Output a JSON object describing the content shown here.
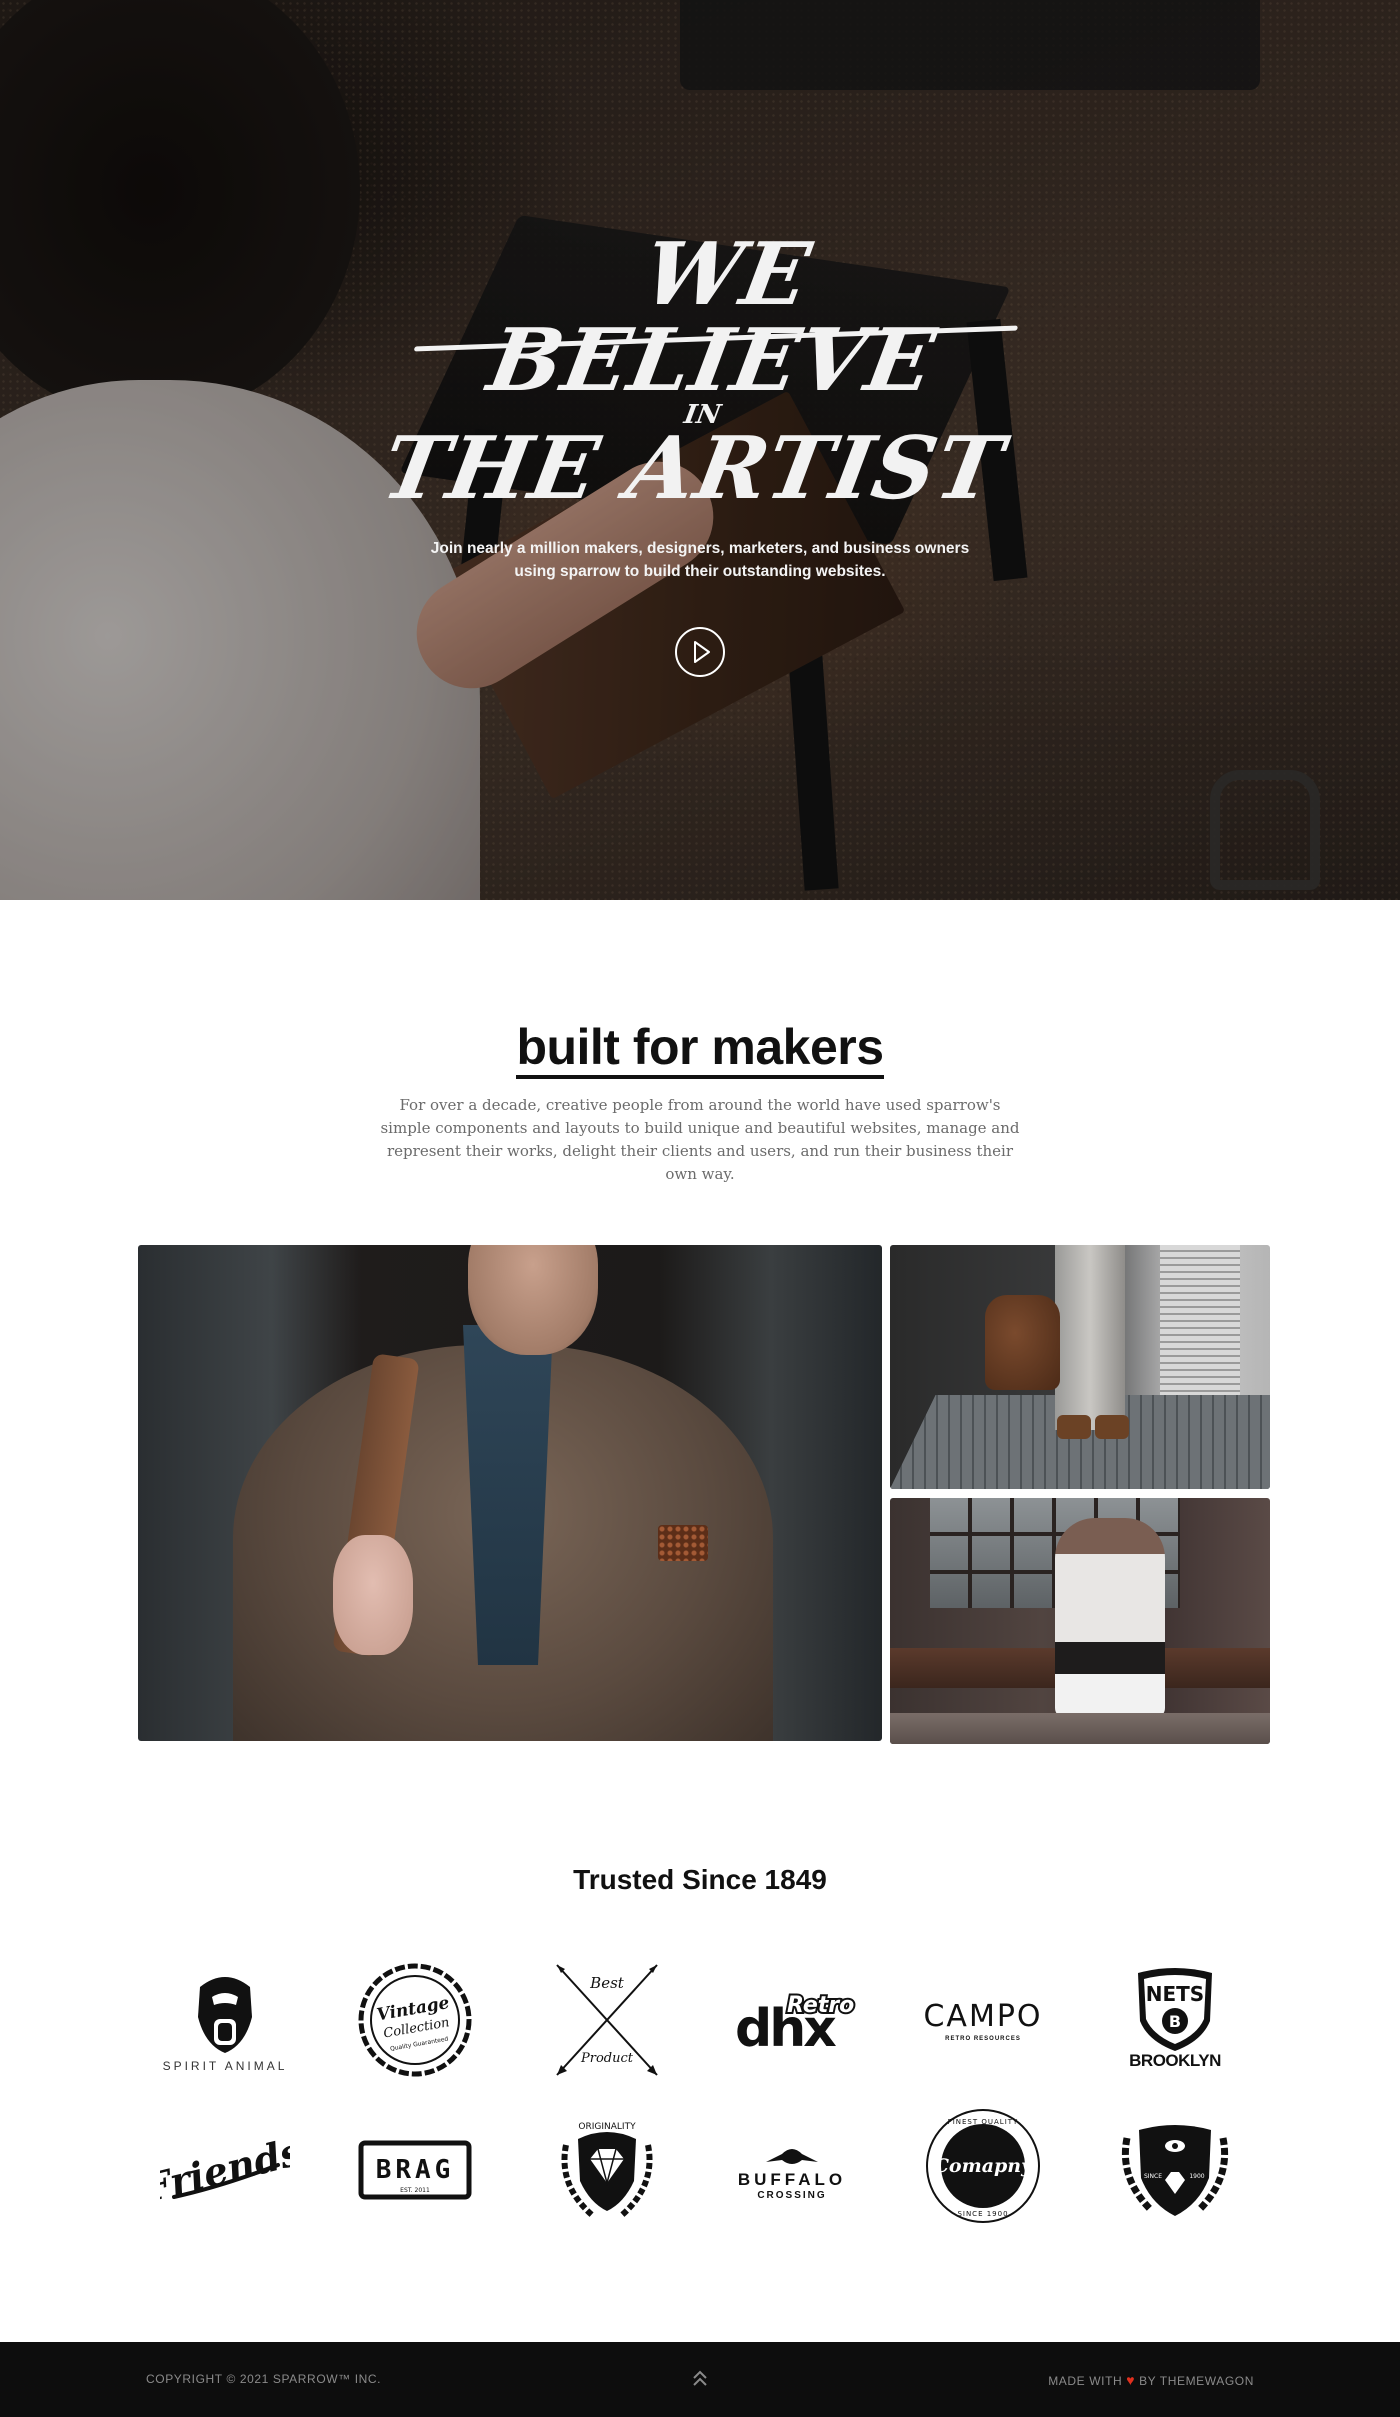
{
  "hero": {
    "title_line1": "We Believe",
    "title_line2": "in",
    "title_line3": "The Artist",
    "subtitle": "Join nearly a million makers, designers, marketers, and business owners using sparrow to build their outstanding websites.",
    "play_icon": "play-circle-icon"
  },
  "intro": {
    "title": "built for makers",
    "description": "For over a decade, creative people from around the world have used sparrow's simple components and layouts to build unique and beautiful websites, manage and represent their works, delight their clients and users, and run their business their own way."
  },
  "gallery": {
    "images": [
      "man-with-leather-bag",
      "man-standing-with-bag",
      "man-sitting-on-bench"
    ]
  },
  "trusted": {
    "title": "Trusted Since 1849",
    "logos": [
      {
        "name": "spirit-animal",
        "text": "SPIRIT ANIMAL"
      },
      {
        "name": "vintage-collection",
        "text1": "Vintage",
        "text2": "Collection",
        "text3": "Quality Guaranteed"
      },
      {
        "name": "best-product",
        "text1": "Best",
        "text2": "Product"
      },
      {
        "name": "retro-dhx",
        "text1": "dhx",
        "text2": "Retro"
      },
      {
        "name": "campo",
        "text1": "CAMPO",
        "text2": "RETRO RESOURCES"
      },
      {
        "name": "nets-brooklyn",
        "text1": "NETS",
        "text2": "B",
        "text3": "BROOKLYN"
      },
      {
        "name": "friends",
        "text": "Friends"
      },
      {
        "name": "brag",
        "text1": "BRAG",
        "text2": "EST. 2011"
      },
      {
        "name": "originality",
        "text": "ORIGINALITY"
      },
      {
        "name": "buffalo-crossing",
        "text1": "BUFFALO",
        "text2": "CROSSING"
      },
      {
        "name": "comapny",
        "text1": "FINEST QUALITY",
        "text2": "Comapny",
        "text3": "SINCE 1900"
      },
      {
        "name": "since-1900-crest",
        "text1": "SINCE",
        "text2": "1900"
      }
    ]
  },
  "footer": {
    "copyright": "COPYRIGHT © 2021 SPARROW™ INC.",
    "made_prefix": "MADE WITH",
    "made_suffix": "BY THEMEWAGON",
    "heart": "♥",
    "colors": {
      "background": "#0d0d0d",
      "heart": "#e0301e"
    }
  }
}
